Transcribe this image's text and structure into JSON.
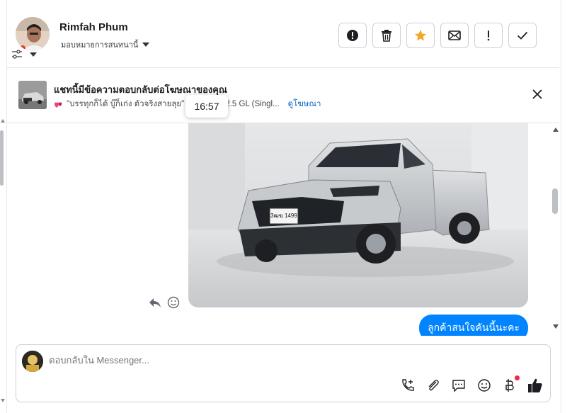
{
  "header": {
    "contact_name": "Rimfah Phum",
    "assign_label": "มอบหมายการสนทนานี้",
    "actions": [
      {
        "name": "report-button",
        "icon": "exclamation-circle-icon"
      },
      {
        "name": "delete-button",
        "icon": "trash-icon"
      },
      {
        "name": "star-button",
        "icon": "star-icon"
      },
      {
        "name": "mark-unread-button",
        "icon": "envelope-icon"
      },
      {
        "name": "follow-up-button",
        "icon": "exclamation-icon"
      },
      {
        "name": "done-button",
        "icon": "check-icon"
      }
    ],
    "star_color": "#f5a623"
  },
  "ad_banner": {
    "title": "แชทนี้มีข้อความตอบกลับต่อโฆษณาของคุณ",
    "ad_text": "\"บรรทุกก็ได้ บู๊ก็เก่ง ตัวจริงสายลุย\" ... All New 2.5 GL (Singl...",
    "view_ad_link": "ดูโฆษณา",
    "tooltip_time": "16:57"
  },
  "messages": {
    "outgoing_text": "ลูกค้าสนใจคันนี้นะคะ",
    "outgoing_color": "#0084ff",
    "photo_plate": "3ฒฆ 1499"
  },
  "composer": {
    "placeholder": "ตอบกลับใน Messenger...",
    "icons": [
      "phone-add-icon",
      "paperclip-icon",
      "saved-reply-icon",
      "emoji-icon",
      "baht-payment-icon",
      "thumbs-up-icon"
    ]
  }
}
